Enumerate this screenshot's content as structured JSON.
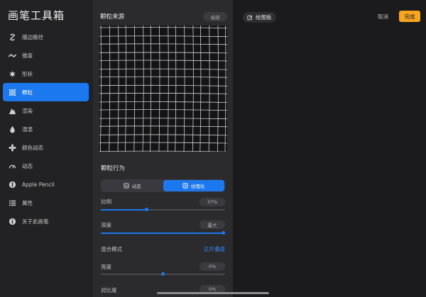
{
  "sidebar": {
    "title": "画笔工具箱",
    "items": [
      {
        "label": "描边路径",
        "icon": "stroke-path-icon"
      },
      {
        "label": "锥度",
        "icon": "taper-icon"
      },
      {
        "label": "形状",
        "icon": "shape-icon"
      },
      {
        "label": "颗粒",
        "icon": "grain-icon",
        "active": true
      },
      {
        "label": "渲染",
        "icon": "rendering-icon"
      },
      {
        "label": "湿混",
        "icon": "wet-mix-icon"
      },
      {
        "label": "颜色动态",
        "icon": "color-dynamics-icon"
      },
      {
        "label": "动态",
        "icon": "dynamics-icon"
      },
      {
        "label": "Apple Pencil",
        "icon": "apple-pencil-icon"
      },
      {
        "label": "属性",
        "icon": "properties-icon"
      },
      {
        "label": "关于此画笔",
        "icon": "about-brush-icon"
      }
    ]
  },
  "grain_source": {
    "title": "颗粒来源",
    "edit_label": "编辑"
  },
  "grain_behavior": {
    "title": "颗粒行为",
    "segments": [
      {
        "label": "动态",
        "active": false
      },
      {
        "label": "纹理化",
        "active": true
      }
    ],
    "scale": {
      "label": "比例",
      "value": "37%",
      "fraction": 0.37
    },
    "depth": {
      "label": "深度",
      "value": "最大",
      "fraction": 1.0
    },
    "blend_mode": {
      "label": "混合模式",
      "value": "正片叠底"
    },
    "brightness": {
      "label": "亮度",
      "value": "0%",
      "fraction": 0.5
    },
    "contrast": {
      "label": "对比度",
      "value": "0%"
    }
  },
  "drawing_pad": {
    "button_label": "绘图板",
    "cancel_label": "取消",
    "done_label": "完成"
  },
  "colors": {
    "accent": "#1b78ee",
    "done": "#f6a51d"
  }
}
